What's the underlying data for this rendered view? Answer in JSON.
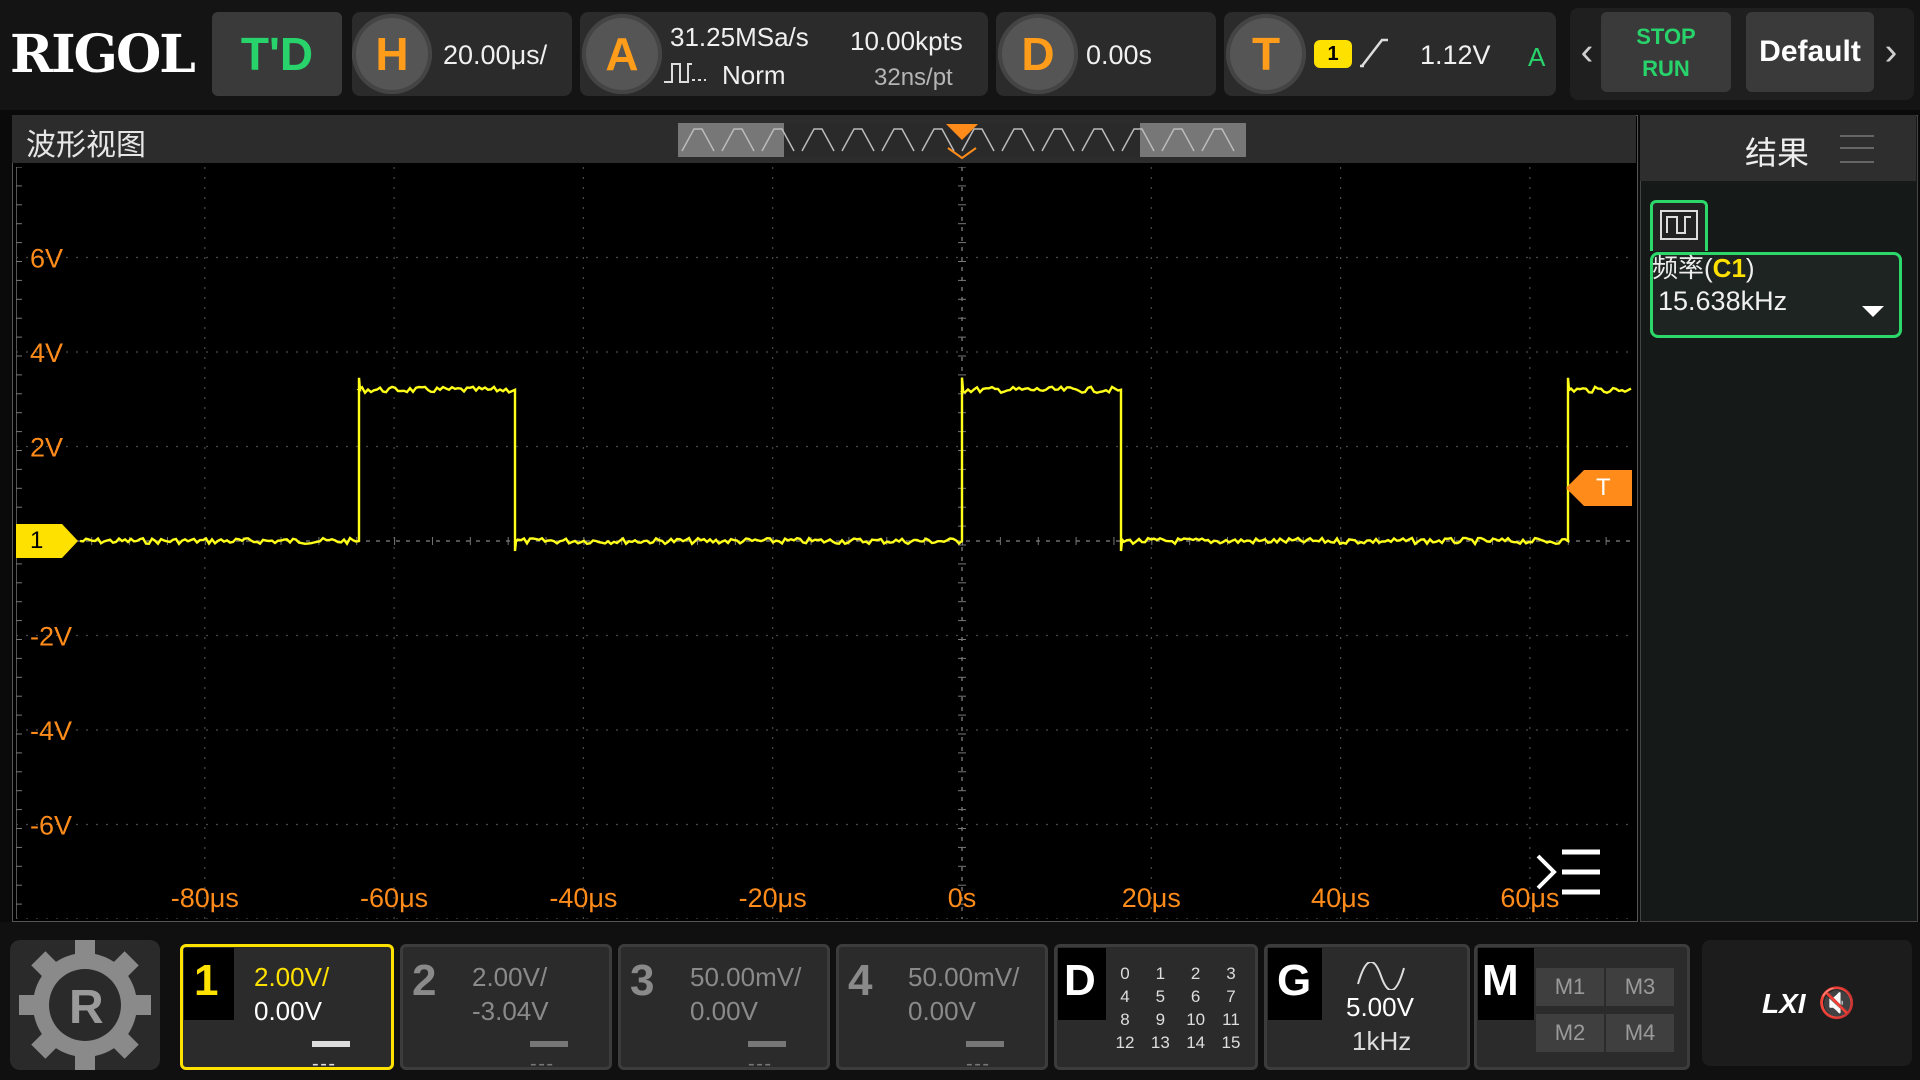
{
  "top": {
    "logo": "RIGOL",
    "mode": "T'D",
    "horizontal": {
      "letter": "H",
      "scale": "20.00μs/"
    },
    "acquire": {
      "letter": "A",
      "sample_rate": "31.25MSa/s",
      "mode": "Norm",
      "memory": "10.00kpts",
      "resolution": "32ns/pt"
    },
    "delay": {
      "letter": "D",
      "value": "0.00s"
    },
    "trigger": {
      "letter": "T",
      "source": "1",
      "level": "1.12V",
      "mode": "A"
    },
    "stop_label": "STOP",
    "run_label": "RUN",
    "default_label": "Default"
  },
  "wave": {
    "title": "波形视图",
    "trigger_marker": "T",
    "trigger_level_marker": "T",
    "channel_marker": "1",
    "y_labels": [
      "6V",
      "4V",
      "2V",
      "-2V",
      "-4V",
      "-6V"
    ],
    "x_labels": [
      "-80μs",
      "-60μs",
      "-40μs",
      "-20μs",
      "0s",
      "20μs",
      "40μs",
      "60μs"
    ],
    "trace_color": "#ffff1a",
    "high_level_v": 3.2,
    "low_level_v": 0.0,
    "pulses_us": [
      [
        -64,
        -47.5
      ],
      [
        0,
        16.5
      ],
      [
        64,
        80
      ]
    ]
  },
  "result": {
    "title": "结果",
    "measurement_prefix": "频率(",
    "measurement_source": "C1",
    "measurement_suffix": ")",
    "measurement_value": "15.638kHz"
  },
  "bottom": {
    "channels": [
      {
        "num": "1",
        "scale": "2.00V/",
        "offset": "0.00V",
        "color": "#ffe100",
        "active": true
      },
      {
        "num": "2",
        "scale": "2.00V/",
        "offset": "-3.04V",
        "color": "#8a8a8a",
        "active": false
      },
      {
        "num": "3",
        "scale": "50.00mV/",
        "offset": "0.00V",
        "color": "#8a8a8a",
        "active": false
      },
      {
        "num": "4",
        "scale": "50.00mV/",
        "offset": "0.00V",
        "color": "#8a8a8a",
        "active": false
      }
    ],
    "digital": {
      "letter": "D",
      "rows": [
        [
          "0",
          "1",
          "2",
          "3"
        ],
        [
          "4",
          "5",
          "6",
          "7"
        ],
        [
          "8",
          "9",
          "10",
          "11"
        ],
        [
          "12",
          "13",
          "14",
          "15"
        ]
      ]
    },
    "generator": {
      "letter": "G",
      "amplitude": "5.00V",
      "frequency": "1kHz"
    },
    "math": {
      "letter": "M",
      "buttons": [
        "M1",
        "M3",
        "M2",
        "M4"
      ]
    },
    "lxi": "LXI",
    "mute_symbol": "🔇"
  }
}
